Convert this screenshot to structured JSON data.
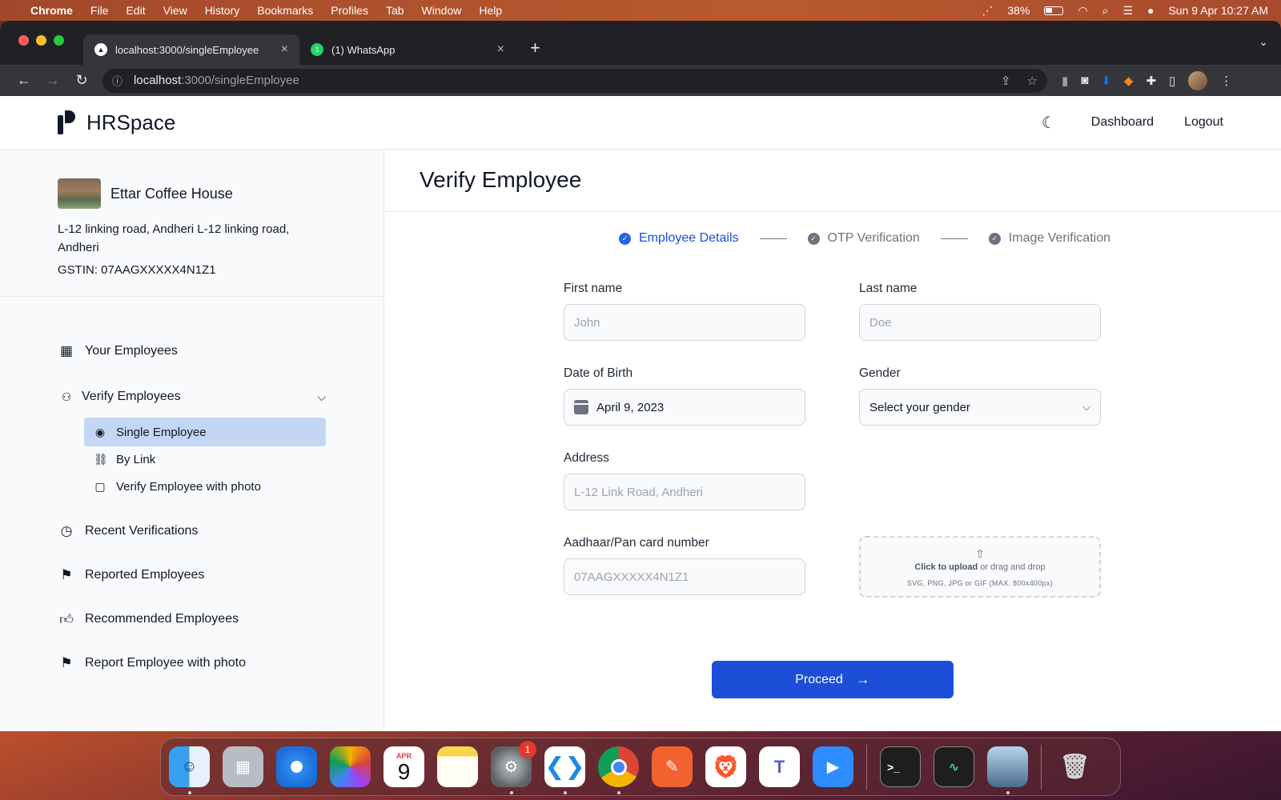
{
  "menubar": {
    "app_name": "Chrome",
    "items": [
      "File",
      "Edit",
      "View",
      "History",
      "Bookmarks",
      "Profiles",
      "Tab",
      "Window",
      "Help"
    ],
    "battery": "38%",
    "datetime": "Sun 9 Apr  10:27 AM"
  },
  "browser": {
    "tabs": [
      {
        "title": "localhost:3000/singleEmployee"
      },
      {
        "title": "(1) WhatsApp"
      }
    ],
    "url_host": "localhost",
    "url_path": ":3000/singleEmployee"
  },
  "header": {
    "brand": "HRSpace",
    "nav": {
      "dashboard": "Dashboard",
      "logout": "Logout"
    }
  },
  "company": {
    "name": "Ettar Coffee House",
    "address": "L-12 linking road, Andheri L-12 linking road, Andheri",
    "gstin": "GSTIN: 07AAGXXXXX4N1Z1"
  },
  "sidebar": {
    "your_employees": "Your Employees",
    "verify_employees": "Verify Employees",
    "sub": {
      "single": "Single Employee",
      "by_link": "By Link",
      "with_photo": "Verify Employee with photo"
    },
    "recent": "Recent Verifications",
    "reported": "Reported Employees",
    "recommended": "Recommended Employees",
    "report_photo": "Report Employee with photo"
  },
  "main": {
    "title": "Verify Employee",
    "steps": [
      "Employee Details",
      "OTP Verification",
      "Image Verification"
    ],
    "form": {
      "first_name": {
        "label": "First name",
        "placeholder": "John"
      },
      "last_name": {
        "label": "Last name",
        "placeholder": "Doe"
      },
      "dob": {
        "label": "Date of Birth",
        "value": "April 9, 2023"
      },
      "gender": {
        "label": "Gender",
        "value": "Select your gender"
      },
      "address": {
        "label": "Address",
        "placeholder": "L-12 Link Road, Andheri"
      },
      "id_number": {
        "label": "Aadhaar/Pan card number",
        "placeholder": "07AAGXXXXX4N1Z1"
      },
      "upload": {
        "bold": "Click to upload",
        "rest": " or drag and drop",
        "hint": "SVG, PNG, JPG or GIF (MAX. 800x400px)"
      }
    },
    "proceed": "Proceed"
  },
  "dock": {
    "calendar_month": "APR",
    "calendar_day": "9",
    "settings_badge": "1"
  }
}
